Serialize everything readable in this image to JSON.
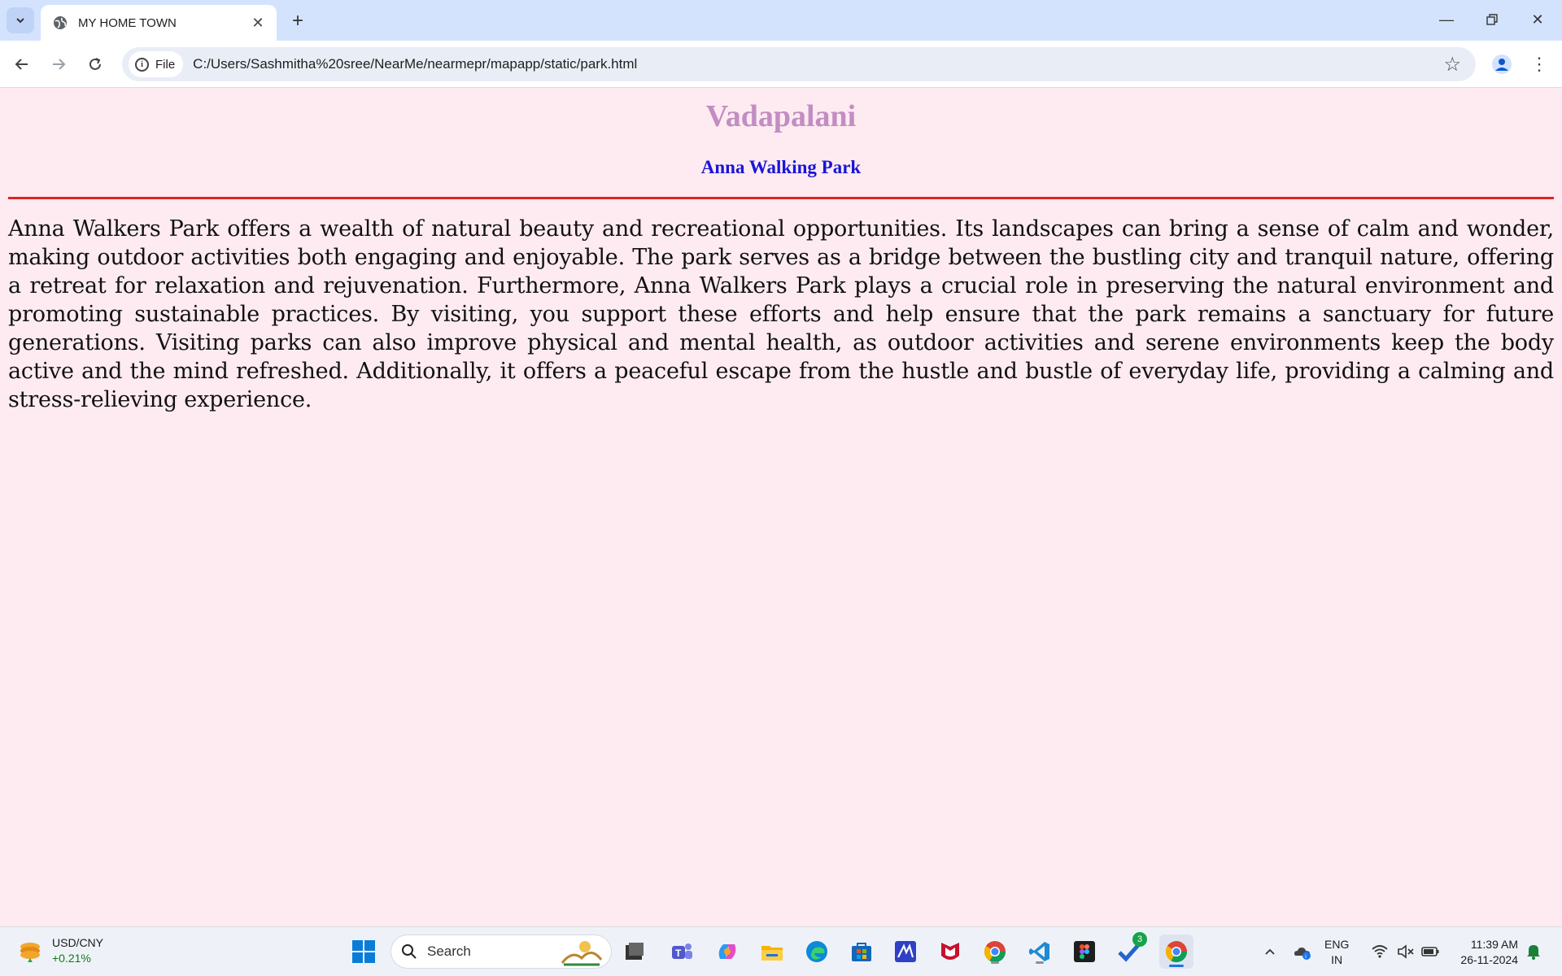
{
  "browser": {
    "tab_title": "MY HOME TOWN",
    "url_chip": "File",
    "url": "C:/Users/Sashmitha%20sree/NearMe/nearmepr/mapapp/static/park.html"
  },
  "page": {
    "heading": "Vadapalani",
    "subheading": "Anna Walking Park",
    "paragraph": "Anna Walkers Park offers a wealth of natural beauty and recreational opportunities. Its landscapes can bring a sense of calm and wonder, making outdoor activities both engaging and enjoyable. The park serves as a bridge between the bustling city and tranquil nature, offering a retreat for relaxation and rejuvenation. Furthermore, Anna Walkers Park plays a crucial role in preserving the natural environment and promoting sustainable practices. By visiting, you support these efforts and help ensure that the park remains a sanctuary for future generations. Visiting parks can also improve physical and mental health, as outdoor activities and serene environments keep the body active and the mind refreshed. Additionally, it offers a peaceful escape from the hustle and bustle of everyday life, providing a calming and stress-relieving experience.",
    "colors": {
      "background": "#fdebf1",
      "heading": "#c28dc2",
      "subheading": "#1a15d6",
      "rule": "#e32222"
    }
  },
  "taskbar": {
    "widget": {
      "label": "USD/CNY",
      "change": "+0.21%"
    },
    "search_placeholder": "Search",
    "badge_count": "3",
    "lang_line1": "ENG",
    "lang_line2": "IN",
    "time": "11:39 AM",
    "date": "26-11-2024",
    "icons": [
      "windows-start-icon",
      "search-icon",
      "task-view-icon",
      "teams-icon",
      "copilot-icon",
      "file-explorer-icon",
      "edge-icon",
      "store-icon",
      "app-icon",
      "mcafee-icon",
      "chrome-icon",
      "vscode-icon",
      "figma-icon",
      "todo-icon",
      "chrome-active-icon",
      "chevron-up-icon",
      "onedrive-icon",
      "wifi-icon",
      "speaker-muted-icon",
      "battery-icon",
      "notification-bell-icon"
    ]
  }
}
